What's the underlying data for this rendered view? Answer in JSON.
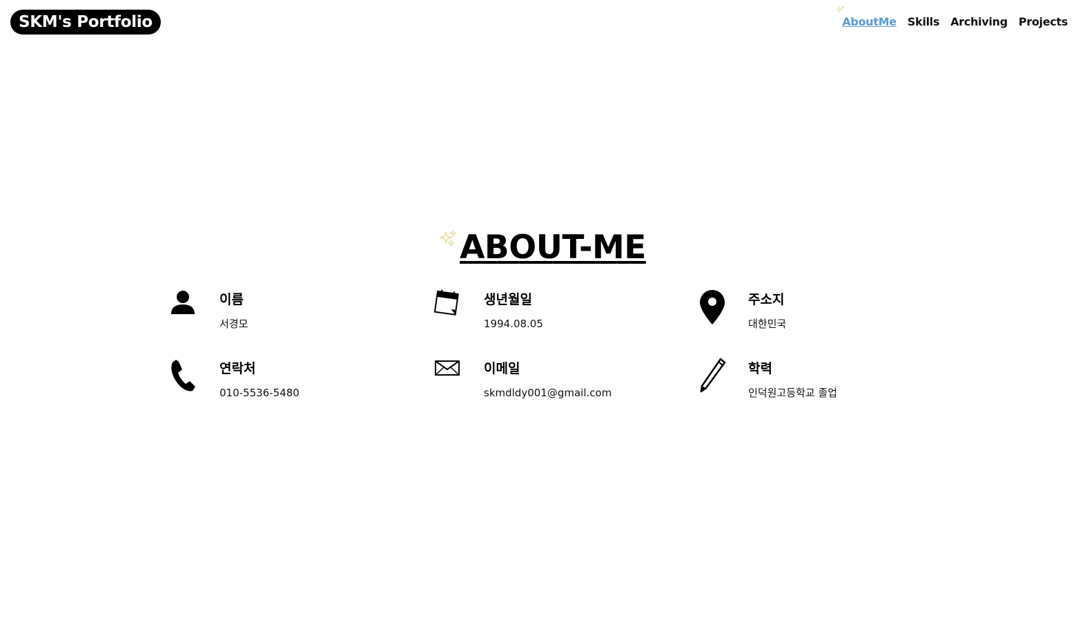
{
  "header": {
    "logo": "SKM's Portfolio",
    "nav": [
      {
        "label": "AboutMe",
        "active": true
      },
      {
        "label": "Skills",
        "active": false
      },
      {
        "label": "Archiving",
        "active": false
      },
      {
        "label": "Projects",
        "active": false
      }
    ]
  },
  "about": {
    "title": "ABOUT-ME",
    "items": [
      {
        "icon": "person-icon",
        "label": "이름",
        "value": "서경모"
      },
      {
        "icon": "calendar-icon",
        "label": "생년월일",
        "value": "1994.08.05"
      },
      {
        "icon": "location-pin-icon",
        "label": "주소지",
        "value": "대한민국"
      },
      {
        "icon": "phone-icon",
        "label": "연락처",
        "value": "010-5536-5480"
      },
      {
        "icon": "envelope-icon",
        "label": "이메일",
        "value": "skmdldy001@gmail.com"
      },
      {
        "icon": "pencil-icon",
        "label": "학력",
        "value": "인덕원고등학교 졸업"
      }
    ]
  },
  "colors": {
    "active_nav": "#5b9bd5",
    "sparkle": "#e8e0a0"
  }
}
